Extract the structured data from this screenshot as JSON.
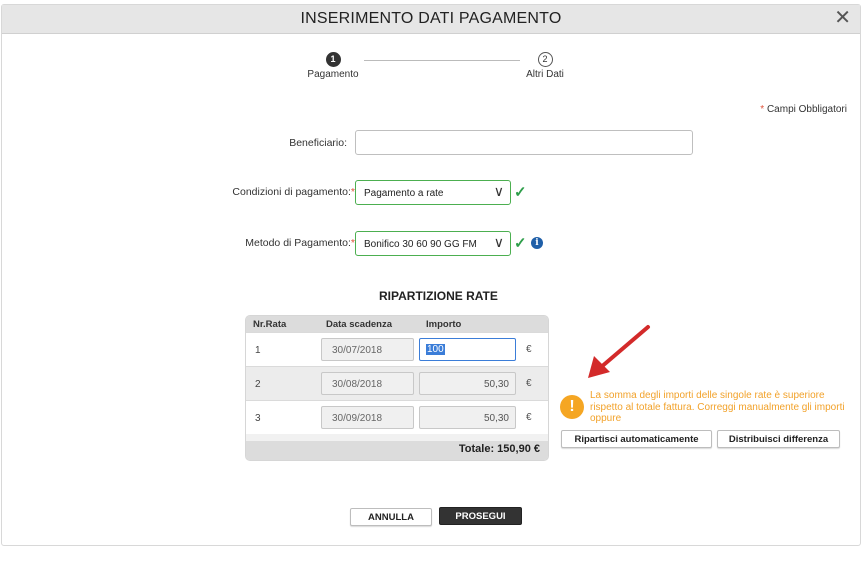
{
  "dialog": {
    "title": "INSERIMENTO DATI PAGAMENTO",
    "close_label": "✕"
  },
  "stepper": {
    "steps": [
      {
        "number": "1",
        "label": "Pagamento",
        "active": true
      },
      {
        "number": "2",
        "label": "Altri Dati",
        "active": false
      }
    ]
  },
  "form": {
    "required_note_star": "*",
    "required_note": "Campi Obbligatori",
    "beneficiario_label": "Beneficiario:",
    "beneficiario_value": "",
    "condizioni_label": "Condizioni di pagamento:",
    "condizioni_value": "Pagamento a rate",
    "metodo_label": "Metodo di Pagamento:",
    "metodo_value": "Bonifico 30 60 90 GG FM",
    "star": "*",
    "check": "✓",
    "chevron": "∨",
    "info_glyph": "i"
  },
  "rate_table": {
    "title": "RIPARTIZIONE RATE",
    "headers": [
      "Nr.Rata",
      "Data scadenza",
      "Importo"
    ],
    "rows": [
      {
        "n": "1",
        "date": "30/07/2018",
        "amount": "100",
        "currency": "€"
      },
      {
        "n": "2",
        "date": "30/08/2018",
        "amount": "50,30",
        "currency": "€"
      },
      {
        "n": "3",
        "date": "30/09/2018",
        "amount": "50,30",
        "currency": "€"
      }
    ],
    "total": "Totale: 150,90 €"
  },
  "warning": {
    "icon": "!",
    "text": "La somma degli importi delle singole rate è superiore rispetto al totale fattura. Correggi manualmente gli importi oppure",
    "btn_auto": "Ripartisci automaticamente",
    "btn_distribute": "Distribuisci differenza"
  },
  "footer": {
    "cancel": "ANNULLA",
    "next": "PROSEGUI"
  },
  "colors": {
    "accent_green": "#2e9e4a",
    "warning_orange": "#f5a623",
    "arrow_red": "#d32a2a",
    "selection_blue": "#3b7dd8"
  }
}
